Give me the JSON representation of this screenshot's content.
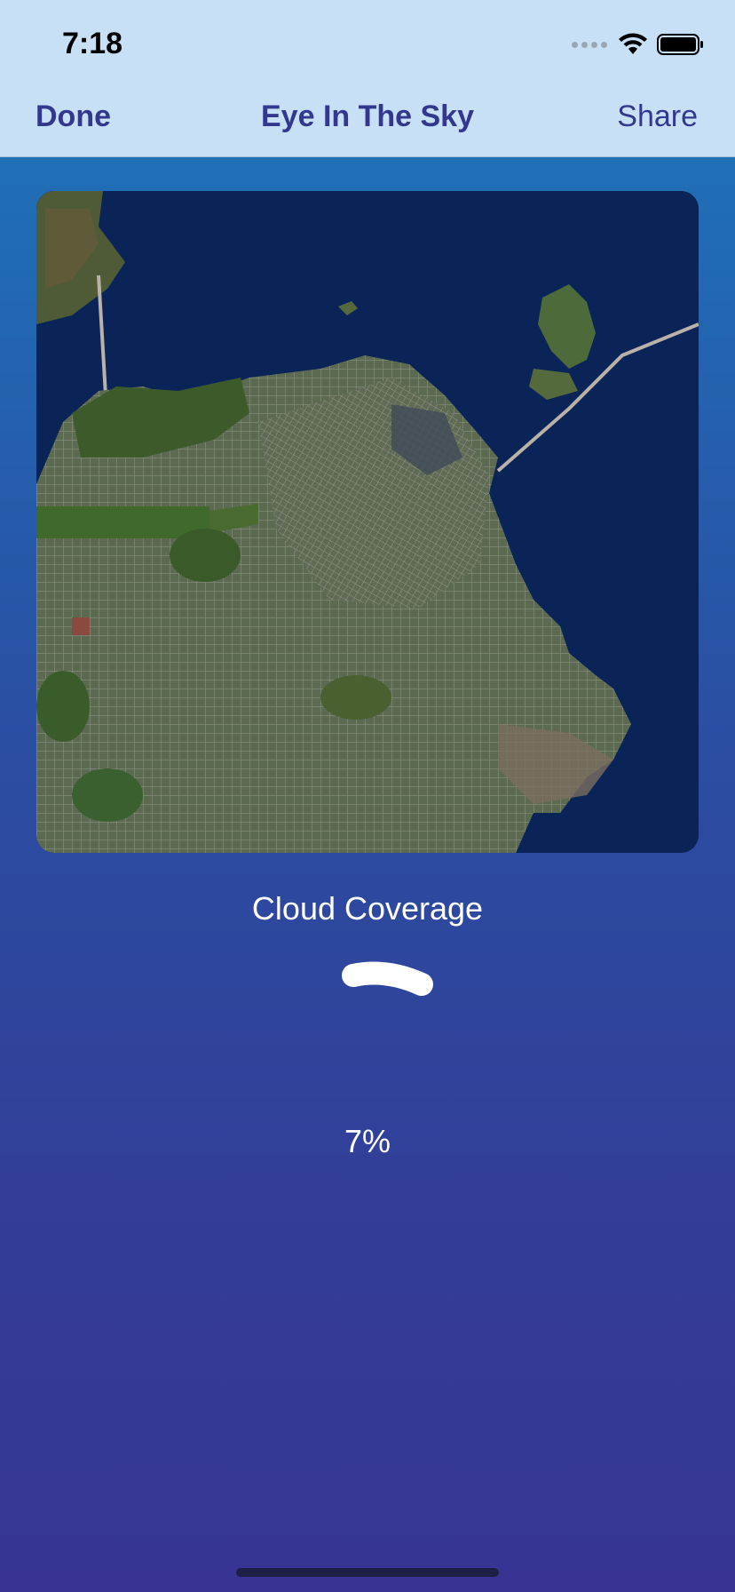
{
  "status_bar": {
    "time": "7:18"
  },
  "nav": {
    "done_label": "Done",
    "title": "Eye In The Sky",
    "share_label": "Share"
  },
  "image": {
    "description_icon": "satellite-map-image"
  },
  "cloud_coverage": {
    "label": "Cloud Coverage",
    "value_text": "7%",
    "fraction": 0.07
  },
  "colors": {
    "nav_tint": "#32388d",
    "topbar_bg": "#c7e0f6",
    "gradient_top": "#1c78bc",
    "gradient_bottom": "#373493"
  }
}
